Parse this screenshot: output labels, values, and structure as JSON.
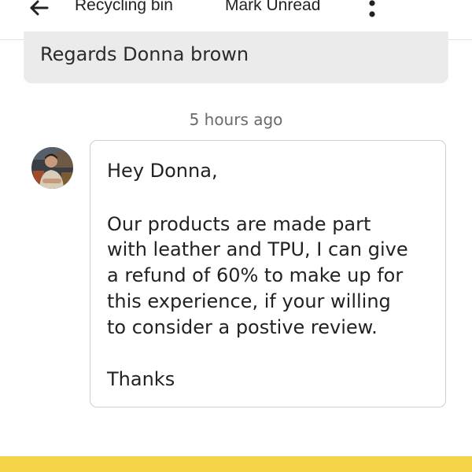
{
  "toolbar": {
    "back_icon": "arrow-left-icon",
    "recycle_label": "Recycling bin",
    "unread_label": "Mark Unread",
    "more_icon": "more-vertical-icon"
  },
  "previous_message": {
    "text": "Regards Donna brown"
  },
  "timestamp": "5 hours ago",
  "reply": {
    "avatar": "seller-avatar",
    "lines": [
      "Hey Donna,",
      "Our products are made part",
      "with leather and TPU, I can give",
      "a refund of 60% to make up for",
      "this experience, if your willing",
      "to consider a postive review.",
      "Thanks"
    ]
  },
  "colors": {
    "bubble_grey": "#ebebeb",
    "accent_yellow": "#f6d449",
    "border": "#cfcfcf",
    "muted_text": "#6b6b6b"
  }
}
